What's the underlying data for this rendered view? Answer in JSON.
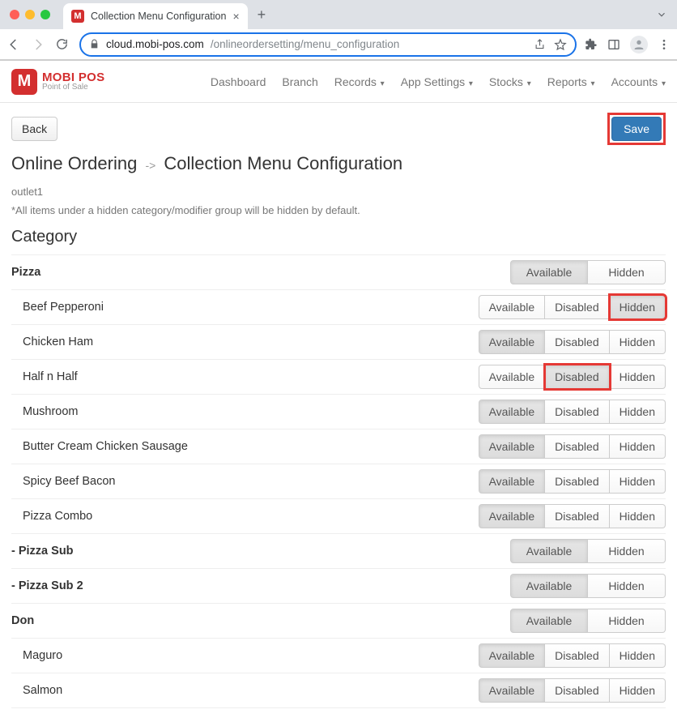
{
  "browser": {
    "tab_title": "Collection Menu Configuration",
    "url_host": "cloud.mobi-pos.com",
    "url_path": "/onlineordersetting/menu_configuration"
  },
  "logo": {
    "mark": "M",
    "title": "MOBI POS",
    "subtitle": "Point of Sale"
  },
  "nav": {
    "items": [
      {
        "label": "Dashboard",
        "dropdown": false
      },
      {
        "label": "Branch",
        "dropdown": false
      },
      {
        "label": "Records",
        "dropdown": true
      },
      {
        "label": "App Settings",
        "dropdown": true
      },
      {
        "label": "Stocks",
        "dropdown": true
      },
      {
        "label": "Reports",
        "dropdown": true
      },
      {
        "label": "Accounts",
        "dropdown": true
      }
    ]
  },
  "actions": {
    "back": "Back",
    "save": "Save"
  },
  "breadcrumb": {
    "parent": "Online Ordering",
    "sep": "->",
    "current": "Collection Menu Configuration"
  },
  "outlet": "outlet1",
  "note": "*All items under a hidden category/modifier group will be hidden by default.",
  "section_heading": "Category",
  "btn_labels": {
    "available": "Available",
    "disabled": "Disabled",
    "hidden": "Hidden"
  },
  "rows": [
    {
      "type": "cat",
      "label": "Pizza",
      "buttons": 2,
      "active": "available"
    },
    {
      "type": "item",
      "label": "Beef Pepperoni",
      "buttons": 3,
      "active": "hidden",
      "highlight": "hidden"
    },
    {
      "type": "item",
      "label": "Chicken Ham",
      "buttons": 3,
      "active": "available"
    },
    {
      "type": "item",
      "label": "Half n Half",
      "buttons": 3,
      "active": "disabled",
      "highlight": "disabled"
    },
    {
      "type": "item",
      "label": "Mushroom",
      "buttons": 3,
      "active": "available"
    },
    {
      "type": "item",
      "label": "Butter Cream Chicken Sausage",
      "buttons": 3,
      "active": "available"
    },
    {
      "type": "item",
      "label": "Spicy Beef Bacon",
      "buttons": 3,
      "active": "available"
    },
    {
      "type": "item",
      "label": "Pizza Combo",
      "buttons": 3,
      "active": "available"
    },
    {
      "type": "cat",
      "label": "- Pizza Sub",
      "buttons": 2,
      "active": "available"
    },
    {
      "type": "cat",
      "label": "- Pizza Sub 2",
      "buttons": 2,
      "active": "available"
    },
    {
      "type": "cat",
      "label": "Don",
      "buttons": 2,
      "active": "available"
    },
    {
      "type": "item",
      "label": "Maguro",
      "buttons": 3,
      "active": "available"
    },
    {
      "type": "item",
      "label": "Salmon",
      "buttons": 3,
      "active": "available"
    }
  ]
}
